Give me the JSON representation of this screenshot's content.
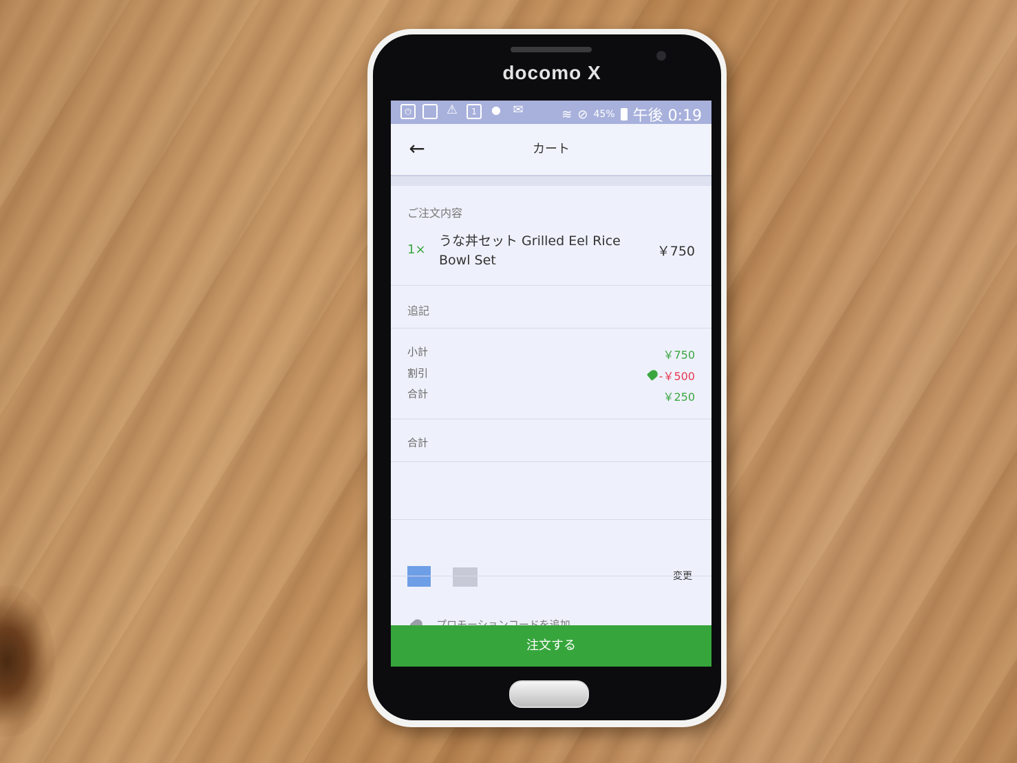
{
  "device": {
    "brand": "docomo X"
  },
  "statusbar": {
    "battery_pct": "45%",
    "time": "午後 0:19",
    "icons": [
      "power-icon",
      "tablet-icon",
      "warning-icon",
      "calendar-icon",
      "evernote-icon",
      "mail-icon",
      "wifi-icon",
      "blocked-icon",
      "battery-icon"
    ]
  },
  "appbar": {
    "title": "カート",
    "back_icon": "arrow-left-icon"
  },
  "order": {
    "section_label": "ご注文内容",
    "items": [
      {
        "qty": "1×",
        "name": "うな丼セット Grilled Eel Rice Bowl Set",
        "price": "￥750"
      }
    ]
  },
  "notes": {
    "label": "追記"
  },
  "summary": {
    "subtotal_label": "小計",
    "subtotal_value": "￥750",
    "discount_label": "割引",
    "discount_value": "-￥500",
    "total_label": "合計",
    "total_value": "￥250"
  },
  "grand_total": {
    "label": "合計"
  },
  "payment": {
    "change_label": "変更",
    "card_color": "#6e9ee6"
  },
  "promo": {
    "label": "プロモーションコードを追加"
  },
  "cta": {
    "label": "注文する",
    "color": "#36a63c"
  },
  "colors": {
    "accent_green": "#3aa640",
    "discount_red": "#e8384f"
  }
}
